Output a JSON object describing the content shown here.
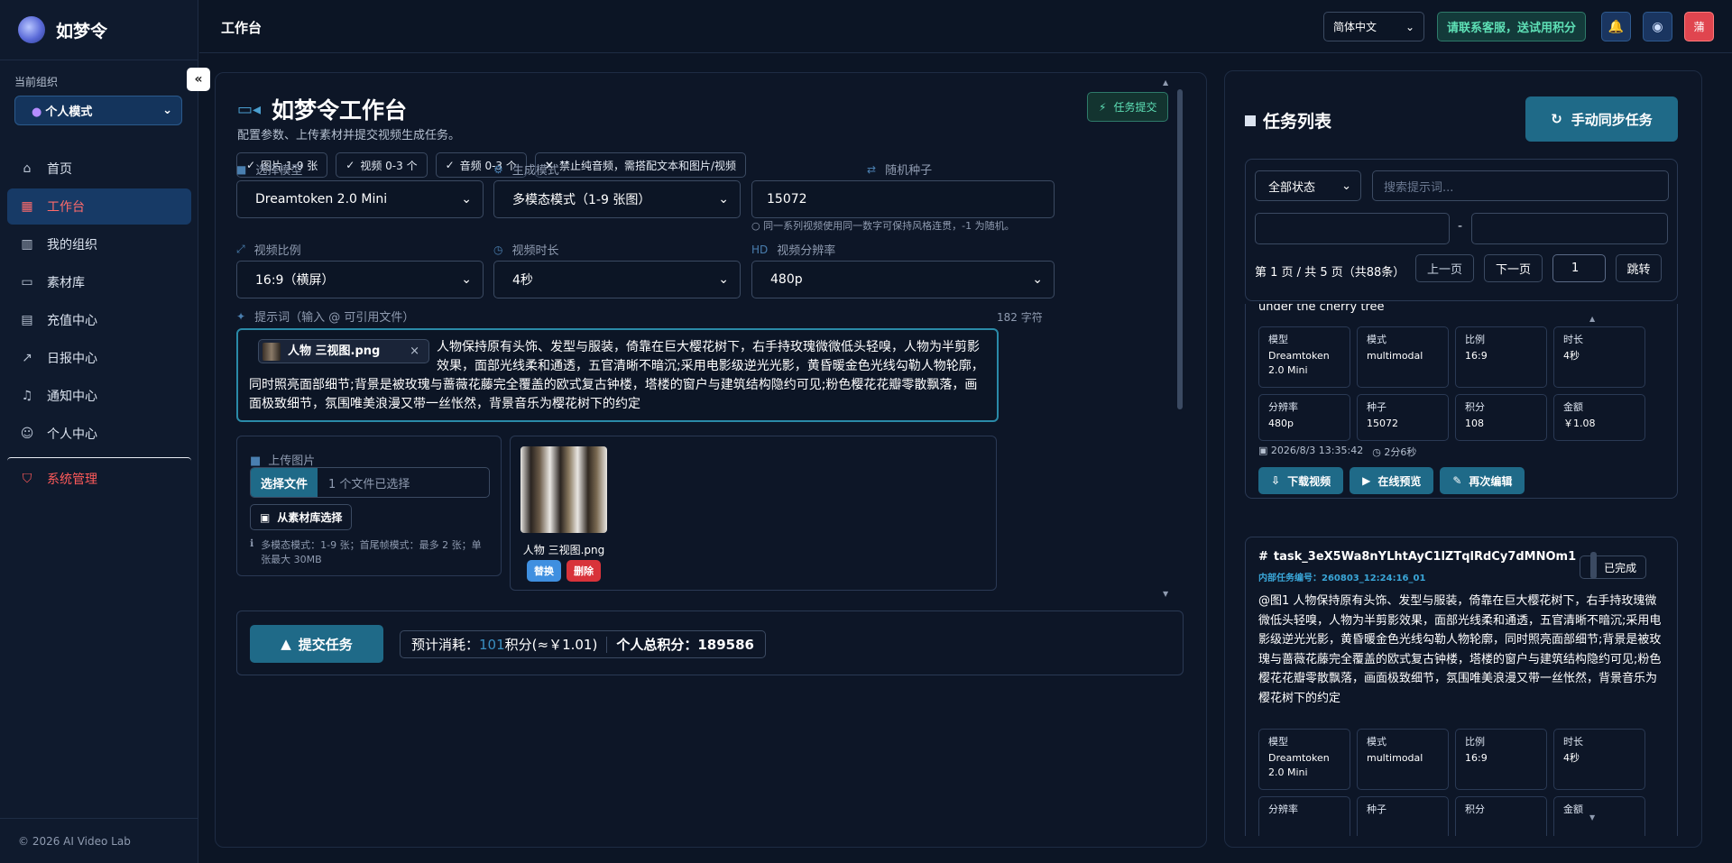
{
  "app": {
    "name": "如梦令",
    "footer": "© 2026 AI Video Lab"
  },
  "sidebar": {
    "org_label": "当前组织",
    "org_value": "个人模式",
    "collapse": "«",
    "items": [
      {
        "label": "首页",
        "icon": "home-icon",
        "glyph": "⌂"
      },
      {
        "label": "工作台",
        "icon": "grid-icon",
        "glyph": "▦"
      },
      {
        "label": "我的组织",
        "icon": "building-icon",
        "glyph": "▥"
      },
      {
        "label": "素材库",
        "icon": "folder-icon",
        "glyph": "▭"
      },
      {
        "label": "充值中心",
        "icon": "calendar-icon",
        "glyph": "▤"
      },
      {
        "label": "日报中心",
        "icon": "chart-icon",
        "glyph": "↗"
      },
      {
        "label": "通知中心",
        "icon": "bell-icon",
        "glyph": "♫"
      },
      {
        "label": "个人中心",
        "icon": "user-icon",
        "glyph": "☺"
      },
      {
        "label": "系统管理",
        "icon": "shield-icon",
        "glyph": "⛉"
      }
    ]
  },
  "topbar": {
    "title": "工作台",
    "lang": "简体中文",
    "contact": "请联系客服，送试用积分",
    "avatar": "蒲"
  },
  "workbench": {
    "title": "如梦令工作台",
    "subtitle": "配置参数、上传素材并提交视频生成任务。",
    "submit_chip": "任务提交",
    "chips": [
      {
        "mark": "✓",
        "text": "图片 1-9 张"
      },
      {
        "mark": "✓",
        "text": "视频 0-3 个"
      },
      {
        "mark": "✓",
        "text": "音频 0-3 个"
      },
      {
        "mark": "×",
        "text": "禁止纯音频，需搭配文本和图片/视频"
      }
    ],
    "model_label": "选择模型",
    "model_value": "Dreamtoken 2.0 Mini",
    "mode_label": "生成模式",
    "mode_value": "多模态模式（1-9 张图）",
    "seed_label": "随机种子",
    "seed_value": "15072",
    "seed_hint": "同一系列视频使用同一数字可保持风格连贯，-1 为随机。",
    "ratio_label": "视频比例",
    "ratio_value": "16:9（横屏）",
    "duration_label": "视频时长",
    "duration_value": "4秒",
    "res_label": "视频分辨率",
    "res_value": "480p",
    "prompt_label": "提示词（输入 @ 可引用文件）",
    "char_count": "182 字符",
    "file_tag": "人物 三视图.png",
    "prompt_text": "人物保持原有头饰、发型与服装，倚靠在巨大樱花树下，右手持玫瑰微微低头轻嗅，人物为半剪影效果，面部光线柔和通透，五官清晰不暗沉;采用电影级逆光光影，黄昏暖金色光线勾勒人物轮廓，同时照亮面部细节;背景是被玫瑰与蔷薇花藤完全覆盖的欧式复古钟楼，塔楼的窗户与建筑结构隐约可见;粉色樱花花瓣零散飘落，画面极致细节，氛围唯美浪漫又带一丝怅然，背景音乐为樱花树下的约定",
    "upload_label": "上传图片",
    "choose_file": "选择文件",
    "file_status": "1 个文件已选择",
    "lib_btn": "从素材库选择",
    "upload_hint": "多模态模式：1-9 张；首尾帧模式：最多 2 张；单张最大 30MB",
    "preview_name": "人物 三视图.png",
    "replace": "替换",
    "delete": "删除",
    "submit_btn": "提交任务",
    "cost_prefix": "预计消耗：",
    "cost_num": "101",
    "cost_suffix": "积分(≈￥1.01)",
    "total": "个人总积分：189586"
  },
  "tasks": {
    "title": "任务列表",
    "sync": "手动同步任务",
    "status_filter": "全部状态",
    "search_placeholder": "搜索提示词...",
    "page_info": "第 1 页 / 共 5 页（共88条）",
    "prev": "上一页",
    "next": "下一页",
    "page_input": "1",
    "jump": "跳转",
    "card1": {
      "text_tail": "under the cherry tree",
      "cells": [
        {
          "k": "模型",
          "v": "Dreamtoken 2.0 Mini"
        },
        {
          "k": "模式",
          "v": "multimodal"
        },
        {
          "k": "比例",
          "v": "16:9"
        },
        {
          "k": "时长",
          "v": "4秒"
        },
        {
          "k": "分辨率",
          "v": "480p"
        },
        {
          "k": "种子",
          "v": "15072"
        },
        {
          "k": "积分",
          "v": "108"
        },
        {
          "k": "金额",
          "v": "￥1.08"
        }
      ],
      "date": "2026/8/3 13:35:42",
      "elapsed": "2分6秒",
      "download": "下载视频",
      "preview": "在线预览",
      "reedit": "再次编辑"
    },
    "card2": {
      "id": "task_3eX5Wa8nYLhtAyC1lZTqlRdCy7dMNOm1",
      "inner": "内部任务编号：260803_12:24:16_01",
      "status": "已完成",
      "text": "@图1 人物保持原有头饰、发型与服装，倚靠在巨大樱花树下，右手持玫瑰微微低头轻嗅，人物为半剪影效果，面部光线柔和通透，五官清晰不暗沉;采用电影级逆光光影，黄昏暖金色光线勾勒人物轮廓，同时照亮面部细节;背景是被玫瑰与蔷薇花藤完全覆盖的欧式复古钟楼，塔楼的窗户与建筑结构隐约可见;粉色樱花花瓣零散飘落，画面极致细节，氛围唯美浪漫又带一丝怅然，背景音乐为樱花树下的约定",
      "cells": [
        {
          "k": "模型",
          "v": "Dreamtoken 2.0 Mini"
        },
        {
          "k": "模式",
          "v": "multimodal"
        },
        {
          "k": "比例",
          "v": "16:9"
        },
        {
          "k": "时长",
          "v": "4秒"
        },
        {
          "k": "分辨率",
          "v": ""
        },
        {
          "k": "种子",
          "v": ""
        },
        {
          "k": "积分",
          "v": ""
        },
        {
          "k": "金额",
          "v": ""
        }
      ]
    }
  }
}
